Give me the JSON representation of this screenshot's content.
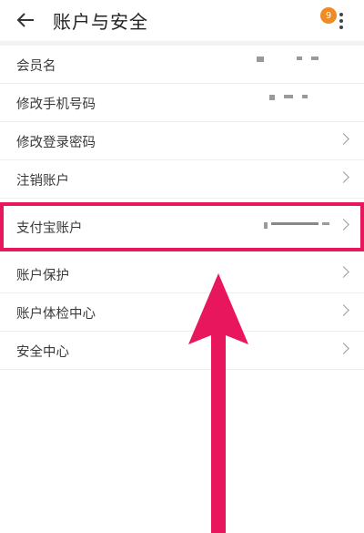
{
  "header": {
    "title": "账户与安全",
    "badge_count": "9"
  },
  "list": {
    "items": [
      {
        "label": "会员名",
        "masked": true,
        "has_chevron": false
      },
      {
        "label": "修改手机号码",
        "masked": true,
        "has_chevron": false
      },
      {
        "label": "修改登录密码",
        "masked": false,
        "has_chevron": true
      },
      {
        "label": "注销账户",
        "masked": false,
        "has_chevron": true
      },
      {
        "label": "支付宝账户",
        "masked": true,
        "has_chevron": true,
        "highlighted": true
      },
      {
        "label": "账户保护",
        "masked": false,
        "has_chevron": true
      },
      {
        "label": "账户体检中心",
        "masked": false,
        "has_chevron": true
      },
      {
        "label": "安全中心",
        "masked": false,
        "has_chevron": true
      }
    ]
  },
  "colors": {
    "highlight": "#e8175d",
    "badge": "#f08a24"
  },
  "icons": {
    "back": "back-arrow-icon",
    "more": "more-vertical-icon"
  }
}
